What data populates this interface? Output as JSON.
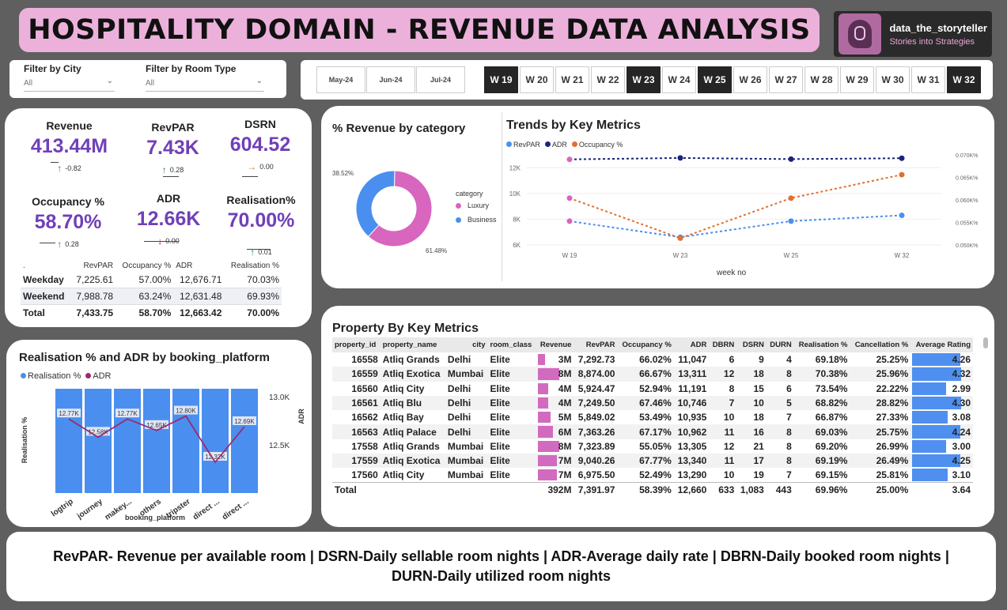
{
  "header": {
    "title": "HOSPITALITY DOMAIN - REVENUE DATA ANALYSIS",
    "logo_name": "data_the_storyteller",
    "logo_tagline": "Stories into Strategies"
  },
  "filters": {
    "city": {
      "label": "Filter by City",
      "value": "All"
    },
    "room_type": {
      "label": "Filter by Room Type",
      "value": "All"
    }
  },
  "months": [
    "May-24",
    "Jun-24",
    "Jul-24"
  ],
  "weeks": [
    {
      "label": "W 19",
      "selected": true
    },
    {
      "label": "W 20",
      "selected": false
    },
    {
      "label": "W 21",
      "selected": false
    },
    {
      "label": "W 22",
      "selected": false
    },
    {
      "label": "W 23",
      "selected": true
    },
    {
      "label": "W 24",
      "selected": false
    },
    {
      "label": "W 25",
      "selected": true
    },
    {
      "label": "W 26",
      "selected": false
    },
    {
      "label": "W 27",
      "selected": false
    },
    {
      "label": "W 28",
      "selected": false
    },
    {
      "label": "W 29",
      "selected": false
    },
    {
      "label": "W 30",
      "selected": false
    },
    {
      "label": "W 31",
      "selected": false
    },
    {
      "label": "W 32",
      "selected": true
    }
  ],
  "kpis": {
    "revenue": {
      "label": "Revenue",
      "value": "413.44M",
      "delta": "-0.82",
      "dir": "up"
    },
    "revpar": {
      "label": "RevPAR",
      "value": "7.43K",
      "delta": "0.28",
      "dir": "up"
    },
    "dsrn": {
      "label": "DSRN",
      "value": "604.52",
      "delta": "0.00",
      "dir": "flat"
    },
    "occupancy": {
      "label": "Occupancy %",
      "value": "58.70%",
      "delta": "0.28",
      "dir": "up"
    },
    "adr": {
      "label": "ADR",
      "value": "12.66K",
      "delta": "0.00",
      "dir": "down"
    },
    "realisation": {
      "label": "Realisation%",
      "value": "70.00%",
      "delta": "0.01",
      "dir": "up"
    }
  },
  "daytype_table": {
    "headers": [
      ".",
      "RevPAR",
      "Occupancy %",
      "ADR",
      "Realisation %"
    ],
    "rows": [
      [
        "Weekday",
        "7,225.61",
        "57.00%",
        "12,676.71",
        "70.03%"
      ],
      [
        "Weekend",
        "7,988.78",
        "63.24%",
        "12,631.48",
        "69.93%"
      ],
      [
        "Total",
        "7,433.75",
        "58.70%",
        "12,663.42",
        "70.00%"
      ]
    ]
  },
  "category_chart": {
    "title": "% Revenue by category",
    "legend_title": "category",
    "chart_data": {
      "type": "pie",
      "categories": [
        "Luxury",
        "Business"
      ],
      "values": [
        61.48,
        38.52
      ],
      "labels": [
        "61.48%",
        "38.52%"
      ],
      "colors": [
        "#d865be",
        "#4a8ff0"
      ]
    }
  },
  "trend_chart": {
    "title": "Trends by Key Metrics",
    "xlabel": "week no",
    "chart_data": {
      "type": "line",
      "x": [
        "W 19",
        "W 23",
        "W 25",
        "W 32"
      ],
      "series": [
        {
          "name": "RevPAR",
          "axis": "left",
          "values": [
            7850,
            6600,
            7850,
            8300
          ],
          "color": "#4a8ff0"
        },
        {
          "name": "ADR",
          "axis": "left",
          "values": [
            12650,
            12760,
            12670,
            12740
          ],
          "color": "#1a237e"
        },
        {
          "name": "Occupancy %",
          "axis": "right",
          "values": [
            0.0604,
            0.0515,
            0.0604,
            0.0656
          ],
          "color": "#e07030"
        }
      ],
      "marker_color_first": "#d865be",
      "y_left_ticks": [
        "6K",
        "8K",
        "10K",
        "12K"
      ],
      "y_left_lim": [
        6000,
        13000
      ],
      "y_right_ticks": [
        "0.050K%",
        "0.055K%",
        "0.060K%",
        "0.065K%",
        "0.070K%"
      ],
      "y_right_lim": [
        0.05,
        0.07
      ]
    }
  },
  "platform_chart": {
    "title": "Realisation % and ADR by booking_platform",
    "xlabel": "booking_platform",
    "ylabel_left": "Realisation %",
    "ylabel_right": "ADR",
    "chart_data": {
      "type": "bar",
      "categories": [
        "logtrip",
        "journey",
        "makey...",
        "others",
        "tripster",
        "direct ...",
        "direct ..."
      ],
      "series": [
        {
          "name": "Realisation %",
          "values": [
            70.1,
            70.0,
            70.0,
            69.9,
            70.0,
            70.0,
            69.9
          ],
          "color": "#4a8ff0"
        },
        {
          "name": "ADR",
          "values": [
            12770,
            12580,
            12770,
            12650,
            12800,
            12320,
            12690
          ],
          "labels": [
            "12.77K",
            "12.58K",
            "12.77K",
            "12.65K",
            "12.80K",
            "12.32K",
            "12.69K"
          ],
          "color": "#9c2a6e"
        }
      ],
      "y_right_ticks": [
        "12.5K",
        "13.0K"
      ],
      "y_right_lim": [
        12000,
        13100
      ]
    }
  },
  "property_table": {
    "title": "Property By Key Metrics",
    "headers": [
      "property_id",
      "property_name",
      "city",
      "room_class",
      "Revenue",
      "RevPAR",
      "Occupancy %",
      "ADR",
      "DBRN",
      "DSRN",
      "DURN",
      "Realisation %",
      "Cancellation %",
      "Average Rating"
    ],
    "rows": [
      [
        "16558",
        "Atliq Grands",
        "Delhi",
        "Elite",
        "3M",
        "7,292.73",
        "66.02%",
        "11,047",
        "6",
        "9",
        "4",
        "69.18%",
        "25.25%",
        "4.26"
      ],
      [
        "16559",
        "Atliq Exotica",
        "Mumbai",
        "Elite",
        "8M",
        "8,874.00",
        "66.67%",
        "13,311",
        "12",
        "18",
        "8",
        "70.38%",
        "25.96%",
        "4.32"
      ],
      [
        "16560",
        "Atliq City",
        "Delhi",
        "Elite",
        "4M",
        "5,924.47",
        "52.94%",
        "11,191",
        "8",
        "15",
        "6",
        "73.54%",
        "22.22%",
        "2.99"
      ],
      [
        "16561",
        "Atliq Blu",
        "Delhi",
        "Elite",
        "4M",
        "7,249.50",
        "67.46%",
        "10,746",
        "7",
        "10",
        "5",
        "68.82%",
        "28.82%",
        "4.30"
      ],
      [
        "16562",
        "Atliq Bay",
        "Delhi",
        "Elite",
        "5M",
        "5,849.02",
        "53.49%",
        "10,935",
        "10",
        "18",
        "7",
        "66.87%",
        "27.33%",
        "3.08"
      ],
      [
        "16563",
        "Atliq Palace",
        "Delhi",
        "Elite",
        "6M",
        "7,363.26",
        "67.17%",
        "10,962",
        "11",
        "16",
        "8",
        "69.03%",
        "25.75%",
        "4.24"
      ],
      [
        "17558",
        "Atliq Grands",
        "Mumbai",
        "Elite",
        "8M",
        "7,323.89",
        "55.05%",
        "13,305",
        "12",
        "21",
        "8",
        "69.20%",
        "26.99%",
        "3.00"
      ],
      [
        "17559",
        "Atliq Exotica",
        "Mumbai",
        "Elite",
        "7M",
        "9,040.26",
        "67.77%",
        "13,340",
        "11",
        "17",
        "8",
        "69.19%",
        "26.49%",
        "4.25"
      ],
      [
        "17560",
        "Atliq City",
        "Mumbai",
        "Elite",
        "7M",
        "6,975.50",
        "52.49%",
        "13,290",
        "10",
        "19",
        "7",
        "69.15%",
        "25.81%",
        "3.10"
      ]
    ],
    "revenue_fill": [
      0.3,
      0.85,
      0.4,
      0.4,
      0.5,
      0.6,
      0.85,
      0.75,
      0.75
    ],
    "rating_fill": [
      0.85,
      0.86,
      0.6,
      0.86,
      0.62,
      0.85,
      0.6,
      0.85,
      0.62
    ],
    "total": [
      "Total",
      "",
      "",
      "",
      "392M",
      "7,391.97",
      "58.39%",
      "12,660",
      "633",
      "1,083",
      "443",
      "69.96%",
      "25.00%",
      "3.64"
    ]
  },
  "footer": {
    "line1": "RevPAR- Revenue per available room | DSRN-Daily sellable room nights | ADR-Average daily rate | DBRN-Daily booked room nights |",
    "line2": "DURN-Daily utilized room nights"
  },
  "colors": {
    "accent_pink": "#ecb1db",
    "kpi_purple": "#7040b8",
    "bar_blue": "#4a8ff0",
    "adr_line": "#9c2a6e"
  }
}
